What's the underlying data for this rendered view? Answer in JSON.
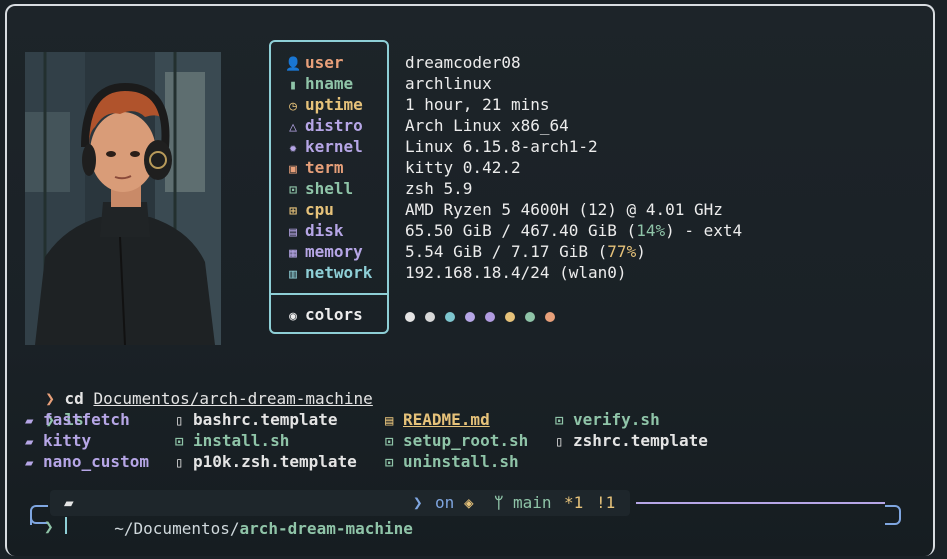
{
  "fetch": {
    "rows": [
      {
        "icon": "user-icon",
        "glyph": "👤",
        "label": "user",
        "label_color": "#e8a07a",
        "value": "dreamcoder08"
      },
      {
        "icon": "server-icon",
        "glyph": "▮",
        "label": "hname",
        "label_color": "#8fc4a8",
        "value": "archlinux"
      },
      {
        "icon": "clock-icon",
        "glyph": "◷",
        "label": "uptime",
        "label_color": "#e6c27a",
        "value": "1 hour, 21 mins"
      },
      {
        "icon": "linux-icon",
        "glyph": "△",
        "label": "distro",
        "label_color": "#b6a6e6",
        "value": "Arch Linux x86_64"
      },
      {
        "icon": "gear-icon",
        "glyph": "✹",
        "label": "kernel",
        "label_color": "#b6a6e6",
        "value": "Linux 6.15.8-arch1-2"
      },
      {
        "icon": "terminal-icon",
        "glyph": "▣",
        "label": "term",
        "label_color": "#e8a07a",
        "value": "kitty 0.42.2"
      },
      {
        "icon": "shell-icon",
        "glyph": "⊡",
        "label": "shell",
        "label_color": "#8fc4a8",
        "value": "zsh 5.9"
      },
      {
        "icon": "cpu-icon",
        "glyph": "⊞",
        "label": "cpu",
        "label_color": "#e6c27a",
        "value": "AMD Ryzen 5 4600H (12) @ 4.01 GHz"
      },
      {
        "icon": "disk-icon",
        "glyph": "▤",
        "label": "disk",
        "label_color": "#b6a6e6",
        "value": "65.50 GiB / 467.40 GiB (",
        "value_hl": "14%",
        "value_tail": ") - ext4",
        "hl_color": "#8fc4a8"
      },
      {
        "icon": "memory-icon",
        "glyph": "▦",
        "label": "memory",
        "label_color": "#b6a6e6",
        "value": "5.54 GiB / 7.17 GiB (",
        "value_hl": "77%",
        "value_tail": ")",
        "hl_color": "#e6c27a"
      },
      {
        "icon": "network-icon",
        "glyph": "▥",
        "label": "network",
        "label_color": "#8ecfd6",
        "value": "192.168.18.4/24 (wlan0)"
      }
    ],
    "colors_label": "colors",
    "palette": [
      "#e4e4e4",
      "#d8d8d8",
      "#7ec6cf",
      "#b6a6e6",
      "#b19be0",
      "#e6c27a",
      "#8fc4a8",
      "#e8a07a"
    ]
  },
  "terminal": {
    "cmd1_prompt": "❯",
    "cmd1_cmd": "cd",
    "cmd1_arg": "Documentos/arch-dream-machine",
    "cmd2_prompt": "❯",
    "cmd2_cmd": "ls",
    "ls": [
      {
        "name": "fastfetch",
        "type": "dir",
        "color": "#b6a6e6"
      },
      {
        "name": "kitty",
        "type": "dir",
        "color": "#b6a6e6"
      },
      {
        "name": "nano_custom",
        "type": "dir",
        "color": "#b6a6e6"
      },
      {
        "name": "bashrc.template",
        "type": "file",
        "color": "#e4e4e4"
      },
      {
        "name": "install.sh",
        "type": "exec",
        "color": "#8fc4a8"
      },
      {
        "name": "p10k.zsh.template",
        "type": "file",
        "color": "#e4e4e4"
      },
      {
        "name": "README.md",
        "type": "md",
        "color": "#e6c27a"
      },
      {
        "name": "setup_root.sh",
        "type": "exec",
        "color": "#8fc4a8"
      },
      {
        "name": "uninstall.sh",
        "type": "exec",
        "color": "#8fc4a8"
      },
      {
        "name": "verify.sh",
        "type": "exec",
        "color": "#8fc4a8"
      },
      {
        "name": "zshrc.template",
        "type": "file",
        "color": "#e4e4e4"
      }
    ],
    "prompt": {
      "path_prefix": "~/Documentos/",
      "path_dir": "arch-dream-machine",
      "on": "on",
      "branch": "main",
      "status1": "*1",
      "status2": "!1",
      "input_prompt": "❯"
    }
  }
}
